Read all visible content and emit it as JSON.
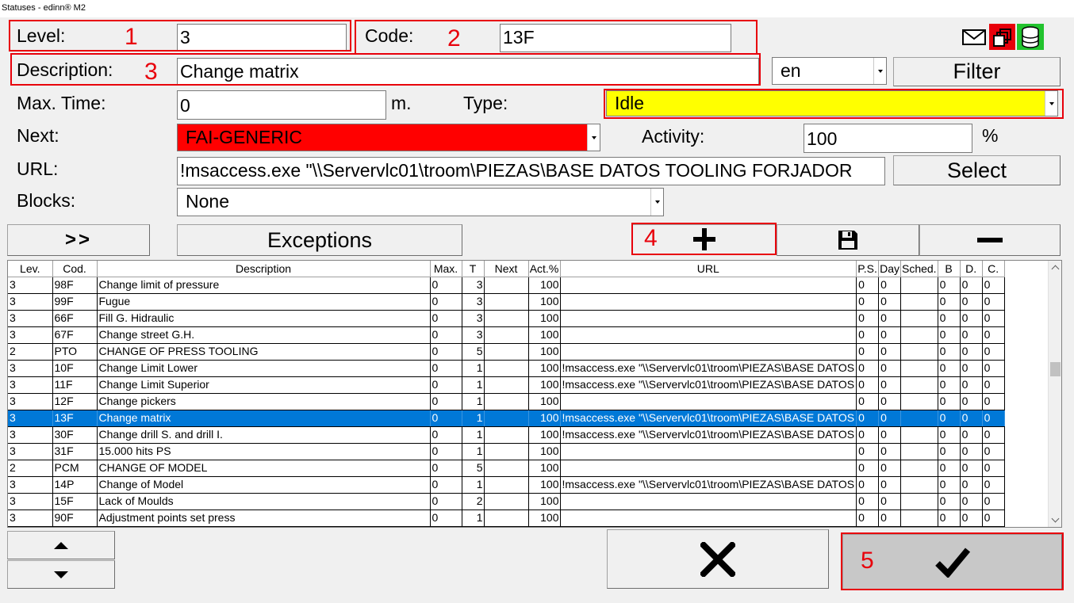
{
  "window": {
    "title": "Statuses - edinn® M2"
  },
  "form": {
    "level_label": "Level:",
    "level_value": "3",
    "code_label": "Code:",
    "code_value": "13F",
    "description_label": "Description:",
    "description_value": "Change matrix",
    "language_value": "en",
    "filter_label": "Filter",
    "maxtime_label": "Max. Time:",
    "maxtime_value": "0",
    "maxtime_unit": "m.",
    "type_label": "Type:",
    "type_value": "Idle",
    "type_color": "#ffff00",
    "next_label": "Next:",
    "next_value": "FAI-GENERIC",
    "next_color": "#ff0000",
    "activity_label": "Activity:",
    "activity_value": "100",
    "activity_unit": "%",
    "url_label": "URL:",
    "url_value": "!msaccess.exe \"\\\\Servervlc01\\troom\\PIEZAS\\BASE DATOS TOOLING FORJADOR",
    "select_label": "Select",
    "blocks_label": "Blocks:",
    "blocks_value": "None"
  },
  "toolbar": {
    "forward_label": ">>",
    "exceptions_label": "Exceptions",
    "icons": [
      "mail-icon",
      "windows-icon",
      "database-icon",
      "plus-icon",
      "save-icon",
      "minus-icon"
    ]
  },
  "annotations": [
    "1",
    "2",
    "3",
    "4",
    "5"
  ],
  "annotation_color": "#e8000b",
  "table": {
    "columns": [
      "Lev.",
      "Cod.",
      "Description",
      "Max.",
      "T",
      "Next",
      "Act.%",
      "URL",
      "P.S.",
      "Day",
      "Sched.",
      "B",
      "D.",
      "C."
    ],
    "rows": [
      [
        "3",
        "98F",
        "Change limit of pressure",
        "0",
        "3",
        "",
        "100",
        "",
        "0",
        "0",
        "",
        "0",
        "0",
        "0"
      ],
      [
        "3",
        "99F",
        "Fugue",
        "0",
        "3",
        "",
        "100",
        "",
        "0",
        "0",
        "",
        "0",
        "0",
        "0"
      ],
      [
        "3",
        "66F",
        "Fill G. Hidraulic",
        "0",
        "3",
        "",
        "100",
        "",
        "0",
        "0",
        "",
        "0",
        "0",
        "0"
      ],
      [
        "3",
        "67F",
        "Change street G.H.",
        "0",
        "3",
        "",
        "100",
        "",
        "0",
        "0",
        "",
        "0",
        "0",
        "0"
      ],
      [
        "2",
        "PTO",
        "CHANGE OF PRESS TOOLING",
        "0",
        "5",
        "",
        "100",
        "",
        "0",
        "0",
        "",
        "0",
        "0",
        "0"
      ],
      [
        "3",
        "10F",
        "Change Limit Lower",
        "0",
        "1",
        "",
        "100",
        "!msaccess.exe \"\\\\Servervlc01\\troom\\PIEZAS\\BASE DATOS",
        "0",
        "0",
        "",
        "0",
        "0",
        "0"
      ],
      [
        "3",
        "11F",
        "Change Limit Superior",
        "0",
        "1",
        "",
        "100",
        "!msaccess.exe \"\\\\Servervlc01\\troom\\PIEZAS\\BASE DATOS",
        "0",
        "0",
        "",
        "0",
        "0",
        "0"
      ],
      [
        "3",
        "12F",
        "Change pickers",
        "0",
        "1",
        "",
        "100",
        "",
        "0",
        "0",
        "",
        "0",
        "0",
        "0"
      ],
      [
        "3",
        "13F",
        "Change matrix",
        "0",
        "1",
        "",
        "100",
        "!msaccess.exe \"\\\\Servervlc01\\troom\\PIEZAS\\BASE DATOS",
        "0",
        "0",
        "",
        "0",
        "0",
        "0"
      ],
      [
        "3",
        "30F",
        "Change drill S. and drill I.",
        "0",
        "1",
        "",
        "100",
        "!msaccess.exe \"\\\\Servervlc01\\troom\\PIEZAS\\BASE DATOS",
        "0",
        "0",
        "",
        "0",
        "0",
        "0"
      ],
      [
        "3",
        "31F",
        "15.000 hits PS",
        "0",
        "1",
        "",
        "100",
        "",
        "0",
        "0",
        "",
        "0",
        "0",
        "0"
      ],
      [
        "2",
        "PCM",
        "CHANGE OF MODEL",
        "0",
        "5",
        "",
        "100",
        "",
        "0",
        "0",
        "",
        "0",
        "0",
        "0"
      ],
      [
        "3",
        "14P",
        "Change of Model",
        "0",
        "1",
        "",
        "100",
        "!msaccess.exe \"\\\\Servervlc01\\troom\\PIEZAS\\BASE DATOS",
        "0",
        "0",
        "",
        "0",
        "0",
        "0"
      ],
      [
        "3",
        "15F",
        "Lack of Moulds",
        "0",
        "2",
        "",
        "100",
        "",
        "0",
        "0",
        "",
        "0",
        "0",
        "0"
      ],
      [
        "3",
        "90F",
        "Adjustment points set press",
        "0",
        "1",
        "",
        "100",
        "",
        "0",
        "0",
        "",
        "0",
        "0",
        "0"
      ]
    ],
    "selected_index": 8
  }
}
